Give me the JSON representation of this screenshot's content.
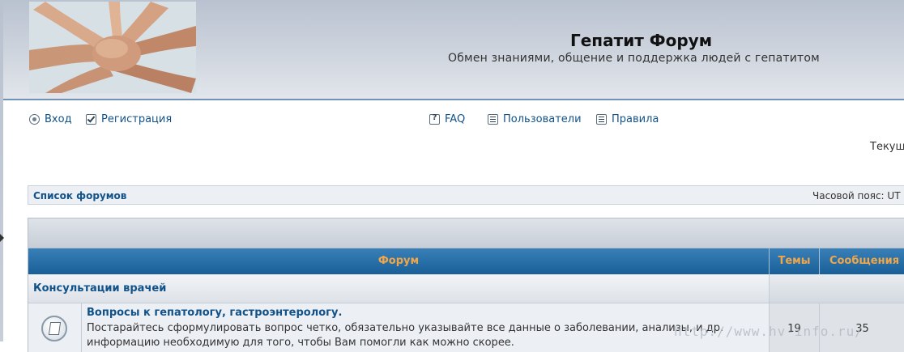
{
  "header": {
    "site_title": "Гепатит Форум",
    "site_description": "Обмен знаниями, общение и поддержка людей с гепатитом"
  },
  "nav": {
    "login": "Вход",
    "register": "Регистрация",
    "faq": "FAQ",
    "members": "Пользователи",
    "rules": "Правила"
  },
  "current_time_label": "Текущ",
  "breadcrumb": {
    "forum_index": "Список форумов",
    "timezone": "Часовой пояс: UT"
  },
  "table": {
    "headers": {
      "forum": "Форум",
      "topics": "Темы",
      "posts": "Сообщения"
    },
    "category": {
      "title": "Консультации врачей"
    },
    "forums": [
      {
        "title": "Вопросы к гепатологу, гастроэнтерологу.",
        "description": "Постарайтесь сформулировать вопрос четко, обязательно указывайте все данные о заболевании, анализы, и др. информацию необходимую для того, чтобы Вам помогли как можно скорее.",
        "topics": "19",
        "posts": "35"
      }
    ]
  },
  "watermark": "http://www.hv-info.ru/",
  "colors": {
    "link": "#105289",
    "header_accent": "#f0a74a",
    "thead_bg": "#1a5f98"
  },
  "icons": {
    "login": "login-icon",
    "register": "register-icon",
    "faq": "faq-icon",
    "members": "members-icon",
    "rules": "rules-icon",
    "forum": "forum-read-icon"
  }
}
